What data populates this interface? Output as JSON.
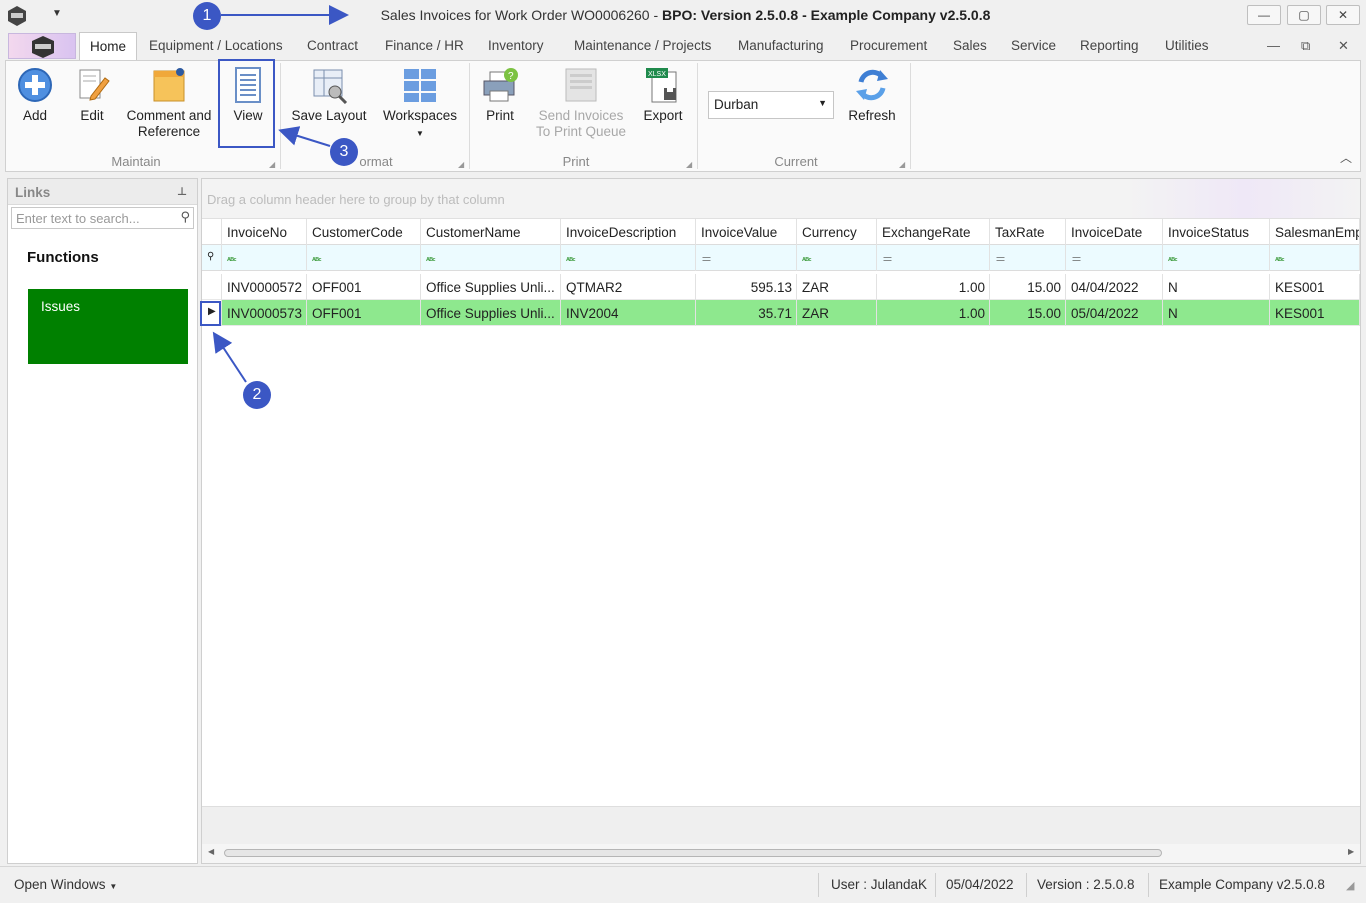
{
  "window": {
    "title_prefix": "Sales Invoices for Work Order WO0006260 - ",
    "title_bold": "BPO: Version 2.5.0.8 - Example Company v2.5.0.8",
    "minimize": "—",
    "maximize": "▢",
    "close": "✕"
  },
  "menu": {
    "tabs": [
      "Home",
      "Equipment / Locations",
      "Contract",
      "Finance / HR",
      "Inventory",
      "Maintenance / Projects",
      "Manufacturing",
      "Procurement",
      "Sales",
      "Service",
      "Reporting",
      "Utilities"
    ],
    "mdi_minimize": "—",
    "mdi_restore": "⧉",
    "mdi_close": "✕"
  },
  "ribbon": {
    "add": "Add",
    "edit": "Edit",
    "comment_line1": "Comment and",
    "comment_line2": "Reference",
    "view": "View",
    "save_layout": "Save Layout",
    "workspaces": "Workspaces",
    "print": "Print",
    "send_line1": "Send Invoices",
    "send_line2": "To Print Queue",
    "export": "Export",
    "site_value": "Durban",
    "refresh": "Refresh",
    "groups": {
      "maintain": "Maintain",
      "format": "ormat",
      "print": "Print",
      "current": "Current"
    }
  },
  "links": {
    "title": "Links",
    "search_placeholder": "Enter text to search...",
    "functions_title": "Functions",
    "tiles": [
      {
        "label": "Issues",
        "color": "#008000"
      }
    ]
  },
  "grid": {
    "group_hint": "Drag a column header here to group by that column",
    "columns": [
      "InvoiceNo",
      "CustomerCode",
      "CustomerName",
      "InvoiceDescription",
      "InvoiceValue",
      "Currency",
      "ExchangeRate",
      "TaxRate",
      "InvoiceDate",
      "InvoiceStatus",
      "SalesmanEmpl"
    ],
    "rows": [
      [
        "INV0000572",
        "OFF001",
        "Office Supplies Unli...",
        "QTMAR2",
        "595.13",
        "ZAR",
        "1.00",
        "15.00",
        "04/04/2022",
        "N",
        "KES001"
      ],
      [
        "INV0000573",
        "OFF001",
        "Office Supplies Unli...",
        "INV2004",
        "35.71",
        "ZAR",
        "1.00",
        "15.00",
        "05/04/2022",
        "N",
        "KES001"
      ]
    ],
    "selected_row_index": 1,
    "selected_color": "#8ee88e"
  },
  "status": {
    "open_windows": "Open Windows",
    "user": "User : JulandaK",
    "date": "05/04/2022",
    "version": "Version : 2.5.0.8",
    "company": "Example Company v2.5.0.8"
  },
  "annotations": {
    "c1": "1",
    "c2": "2",
    "c3": "3",
    "color": "#3b57c4"
  }
}
